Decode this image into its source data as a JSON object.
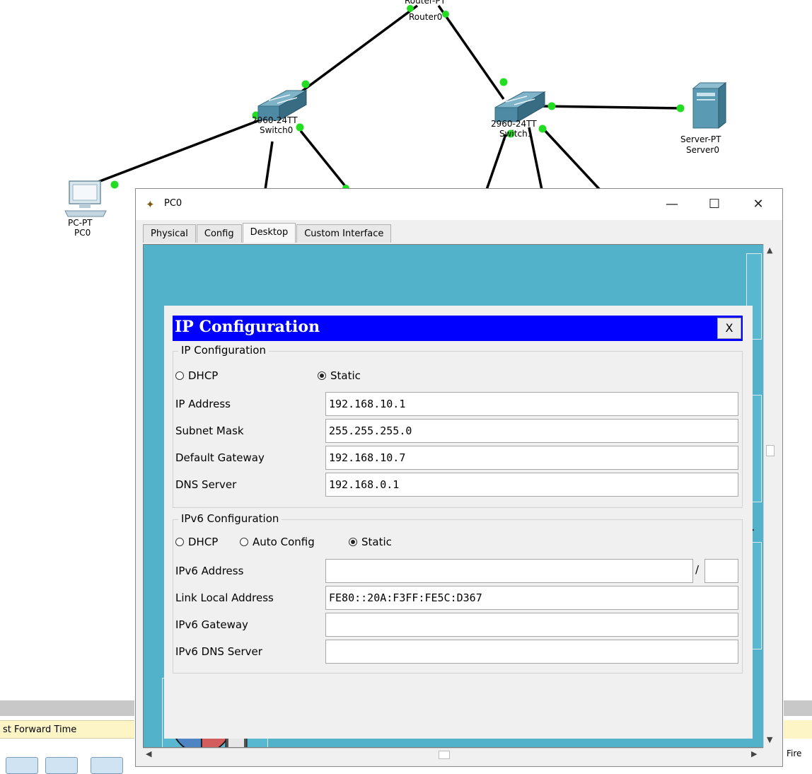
{
  "topology": {
    "router": {
      "name": "Router0",
      "model_partial": "Router-PT"
    },
    "switch0": {
      "model": "2960-24TT",
      "name": "Switch0"
    },
    "switch1": {
      "model": "2960-24TT",
      "name": "Switch1"
    },
    "server": {
      "model": "Server-PT",
      "name": "Server0"
    },
    "pc": {
      "model": "PC-PT",
      "name": "PC0"
    }
  },
  "bottom": {
    "forward_time_label": "st Forward Time",
    "fire_label": "Fire"
  },
  "window": {
    "title": "PC0",
    "minimize_label": "—",
    "maximize_label": "☐",
    "close_label": "✕",
    "tabs": [
      {
        "label": "Physical"
      },
      {
        "label": "Config"
      },
      {
        "label": "Desktop"
      },
      {
        "label": "Custom Interface"
      }
    ],
    "active_tab": "Desktop",
    "bg_text_1": "r",
    "bg_text_2": "or",
    "bg_text_3": "l"
  },
  "ipconfig": {
    "header_title": "IP Configuration",
    "close_label": "X",
    "ipv4": {
      "legend": "IP Configuration",
      "dhcp_label": "DHCP",
      "static_label": "Static",
      "mode": "Static",
      "ip_address_label": "IP Address",
      "ip_address": "192.168.10.1",
      "subnet_mask_label": "Subnet Mask",
      "subnet_mask": "255.255.255.0",
      "default_gateway_label": "Default Gateway",
      "default_gateway": "192.168.10.7",
      "dns_server_label": "DNS Server",
      "dns_server": "192.168.0.1"
    },
    "ipv6": {
      "legend": "IPv6 Configuration",
      "dhcp_label": "DHCP",
      "auto_label": "Auto Config",
      "static_label": "Static",
      "mode": "Static",
      "address_label": "IPv6 Address",
      "address": "",
      "prefix": "",
      "slash": "/",
      "link_local_label": "Link Local Address",
      "link_local": "FE80::20A:F3FF:FE5C:D367",
      "gateway_label": "IPv6 Gateway",
      "gateway": "",
      "dns_label": "IPv6 DNS Server",
      "dns": ""
    }
  },
  "colors": {
    "desktop_bg": "#51b2c9",
    "header_blue": "#0000ff",
    "link_green": "#22dd22"
  }
}
